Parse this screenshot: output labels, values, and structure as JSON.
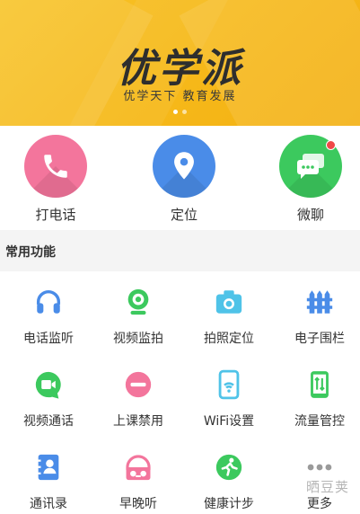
{
  "banner": {
    "brand": "优学派",
    "slogan": "优学天下 教育发展",
    "colors": {
      "background": "#f6b91a",
      "brand_text": "#2e2e2e"
    }
  },
  "actions": [
    {
      "label": "打电话",
      "icon": "phone-icon",
      "color": "#f3759c"
    },
    {
      "label": "定位",
      "icon": "location-pin-icon",
      "color": "#4a8ce8"
    },
    {
      "label": "微聊",
      "icon": "chat-bubbles-icon",
      "color": "#3cc95e",
      "has_badge": true
    }
  ],
  "section": {
    "title": "常用功能"
  },
  "features": [
    {
      "label": "电话监听",
      "icon": "headphones-icon",
      "color": "#4a8ce8"
    },
    {
      "label": "视频监拍",
      "icon": "webcam-icon",
      "color": "#3cc95e"
    },
    {
      "label": "拍照定位",
      "icon": "camera-icon",
      "color": "#4fc3e8"
    },
    {
      "label": "电子围栏",
      "icon": "fence-icon",
      "color": "#4a8ce8"
    },
    {
      "label": "视频通话",
      "icon": "video-call-icon",
      "color": "#3cc95e"
    },
    {
      "label": "上课禁用",
      "icon": "no-entry-icon",
      "color": "#f3759c"
    },
    {
      "label": "WiFi设置",
      "icon": "wifi-phone-icon",
      "color": "#4fc3e8"
    },
    {
      "label": "流量管控",
      "icon": "data-traffic-icon",
      "color": "#3cc95e"
    },
    {
      "label": "通讯录",
      "icon": "contacts-icon",
      "color": "#4a8ce8"
    },
    {
      "label": "早晚听",
      "icon": "radio-headphones-icon",
      "color": "#f3759c"
    },
    {
      "label": "健康计步",
      "icon": "step-counter-icon",
      "color": "#3cc95e"
    },
    {
      "label": "更多",
      "icon": "more-dots-icon",
      "color": "#9a9a9a"
    }
  ],
  "watermark": "晒豆荚"
}
